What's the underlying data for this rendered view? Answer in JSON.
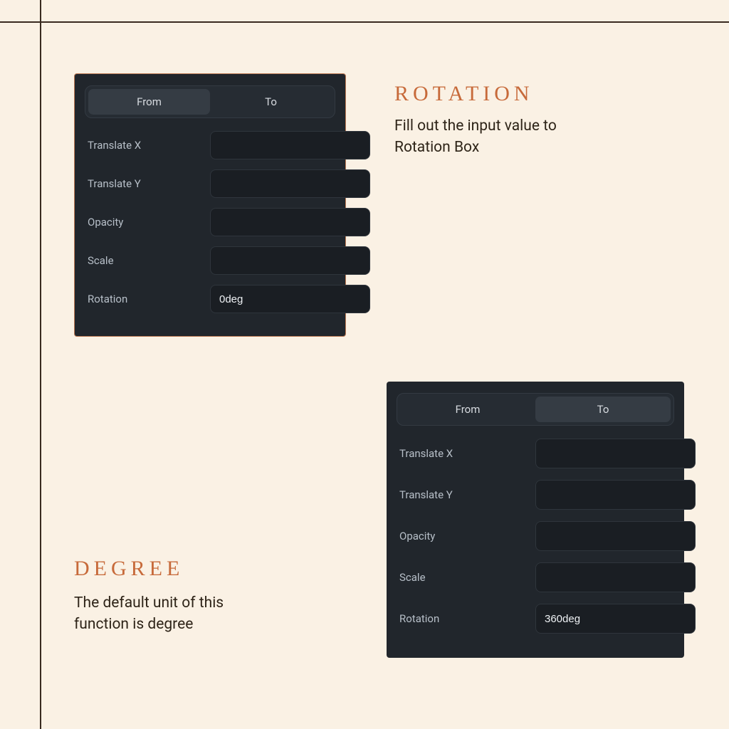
{
  "section1": {
    "heading": "ROTATION",
    "caption": "Fill out the input value to Rotation Box"
  },
  "section2": {
    "heading": "DEGREE",
    "caption": "The default unit of this function is degree"
  },
  "tabs": {
    "from": "From",
    "to": "To"
  },
  "fields": {
    "translateX": "Translate X",
    "translateY": "Translate Y",
    "opacity": "Opacity",
    "scale": "Scale",
    "rotation": "Rotation"
  },
  "panelA": {
    "activeTab": "from",
    "values": {
      "translateX": "",
      "translateY": "",
      "opacity": "",
      "scale": "",
      "rotation": "0deg"
    }
  },
  "panelB": {
    "activeTab": "to",
    "values": {
      "translateX": "",
      "translateY": "",
      "opacity": "",
      "scale": "",
      "rotation": "360deg"
    }
  }
}
